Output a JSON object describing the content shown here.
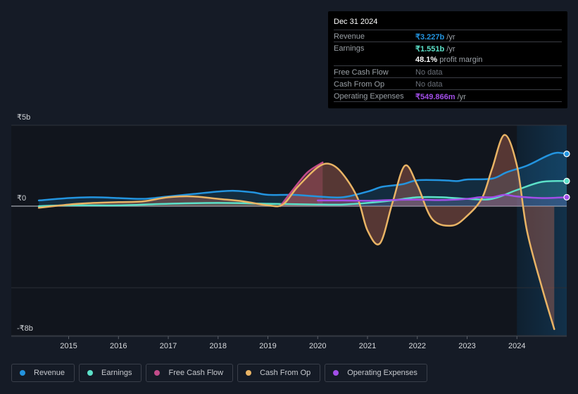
{
  "tooltip": {
    "date": "Dec 31 2024",
    "rows": [
      {
        "label": "Revenue",
        "value": "₹3.227b",
        "unit": " /yr",
        "color": "#2394df"
      },
      {
        "label": "Earnings",
        "value": "₹1.551b",
        "unit": " /yr",
        "color": "#5ce1c9"
      },
      {
        "label": "",
        "value": "48.1%",
        "unit": " profit margin",
        "color": "#ffffff"
      },
      {
        "label": "Free Cash Flow",
        "value": "No data",
        "unit": "",
        "color": "#6b7079"
      },
      {
        "label": "Cash From Op",
        "value": "No data",
        "unit": "",
        "color": "#6b7079"
      },
      {
        "label": "Operating Expenses",
        "value": "₹549.866m",
        "unit": " /yr",
        "color": "#a24ee8"
      }
    ]
  },
  "legend": [
    {
      "label": "Revenue",
      "color": "#2394df"
    },
    {
      "label": "Earnings",
      "color": "#5ce1c9"
    },
    {
      "label": "Free Cash Flow",
      "color": "#c24b8a"
    },
    {
      "label": "Cash From Op",
      "color": "#e9b465"
    },
    {
      "label": "Operating Expenses",
      "color": "#a24ee8"
    }
  ],
  "chart_data": {
    "type": "line",
    "title": "",
    "xlabel": "",
    "ylabel": "",
    "y_tick_labels": [
      "₹5b",
      "₹0",
      "-₹8b"
    ],
    "y_ticks": [
      5,
      0,
      -8
    ],
    "ylim": [
      -8,
      5
    ],
    "x_tick_labels": [
      "2015",
      "2016",
      "2017",
      "2018",
      "2019",
      "2020",
      "2021",
      "2022",
      "2023",
      "2024"
    ],
    "xlim": [
      2014.3,
      2025.0
    ],
    "highlight_from": 2024.0,
    "grid": true,
    "legend_position": "bottom",
    "series": [
      {
        "name": "Revenue",
        "color": "#2394df",
        "x": [
          2014.4,
          2015.0,
          2015.5,
          2016.0,
          2016.5,
          2017.0,
          2017.5,
          2018.0,
          2018.3,
          2018.7,
          2019.0,
          2019.5,
          2020.0,
          2020.5,
          2021.0,
          2021.3,
          2021.7,
          2022.0,
          2022.5,
          2022.8,
          2023.0,
          2023.5,
          2023.8,
          2024.2,
          2024.6,
          2024.8,
          2025.0
        ],
        "y": [
          0.35,
          0.5,
          0.55,
          0.5,
          0.45,
          0.6,
          0.75,
          0.9,
          0.95,
          0.85,
          0.7,
          0.7,
          0.6,
          0.55,
          0.9,
          1.2,
          1.35,
          1.6,
          1.6,
          1.55,
          1.65,
          1.7,
          2.1,
          2.5,
          3.1,
          3.3,
          3.227
        ]
      },
      {
        "name": "Earnings",
        "color": "#5ce1c9",
        "x": [
          2014.4,
          2015.0,
          2016.0,
          2017.0,
          2018.0,
          2019.0,
          2020.0,
          2020.5,
          2021.0,
          2021.5,
          2022.0,
          2022.5,
          2023.0,
          2023.5,
          2024.0,
          2024.5,
          2025.0
        ],
        "y": [
          0.0,
          0.05,
          0.05,
          0.15,
          0.2,
          0.15,
          0.1,
          0.1,
          0.2,
          0.35,
          0.55,
          0.55,
          0.45,
          0.45,
          1.0,
          1.5,
          1.551
        ]
      },
      {
        "name": "Free Cash Flow",
        "color": "#c24b8a",
        "x": [
          2019.25,
          2019.5,
          2019.8,
          2020.1
        ],
        "y": [
          0.0,
          1.0,
          2.1,
          2.7
        ]
      },
      {
        "name": "Cash From Op",
        "color": "#e9b465",
        "x": [
          2014.4,
          2015.0,
          2015.5,
          2016.0,
          2016.5,
          2017.0,
          2017.5,
          2018.0,
          2018.5,
          2019.0,
          2019.3,
          2019.6,
          2020.0,
          2020.25,
          2020.5,
          2020.8,
          2021.0,
          2021.25,
          2021.5,
          2021.75,
          2022.0,
          2022.3,
          2022.7,
          2023.0,
          2023.3,
          2023.5,
          2023.75,
          2024.0,
          2024.2,
          2024.5,
          2024.75
        ],
        "y": [
          -0.1,
          0.1,
          0.2,
          0.25,
          0.3,
          0.55,
          0.6,
          0.45,
          0.3,
          0.05,
          0.1,
          1.2,
          2.4,
          2.6,
          2.0,
          0.5,
          -1.5,
          -2.3,
          0.2,
          2.5,
          1.3,
          -0.8,
          -1.2,
          -0.6,
          0.5,
          2.3,
          4.4,
          2.5,
          -1.5,
          -5.0,
          -7.6
        ]
      },
      {
        "name": "Operating Expenses",
        "color": "#a24ee8",
        "x": [
          2020.0,
          2020.5,
          2021.0,
          2021.5,
          2022.0,
          2022.5,
          2023.0,
          2023.25,
          2023.5,
          2023.75,
          2024.0,
          2024.5,
          2025.0
        ],
        "y": [
          0.35,
          0.35,
          0.33,
          0.38,
          0.4,
          0.38,
          0.45,
          0.55,
          0.55,
          0.7,
          0.6,
          0.5,
          0.55
        ]
      }
    ]
  }
}
